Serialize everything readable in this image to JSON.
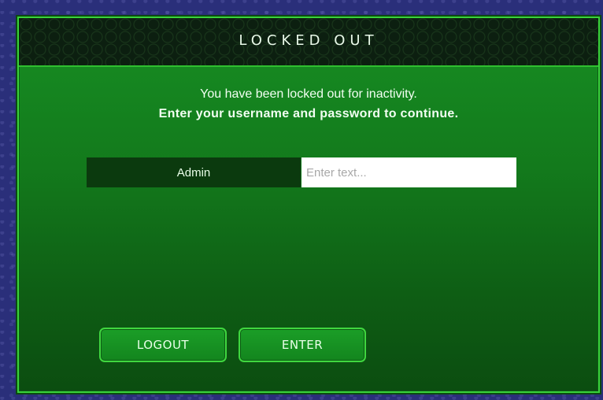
{
  "dialog": {
    "title": "LOCKED OUT",
    "message_line1": "You have been locked out for inactivity.",
    "message_line2": "Enter your username and password to continue."
  },
  "login": {
    "username": "Admin",
    "password_placeholder": "Enter text...",
    "password_value": ""
  },
  "buttons": {
    "logout_label": "LOGOUT",
    "enter_label": "ENTER"
  },
  "colors": {
    "background": "#2a2f7a",
    "panel_green": "#137a1c",
    "border_green": "#39d23a",
    "username_box": "#0b3a0e"
  }
}
